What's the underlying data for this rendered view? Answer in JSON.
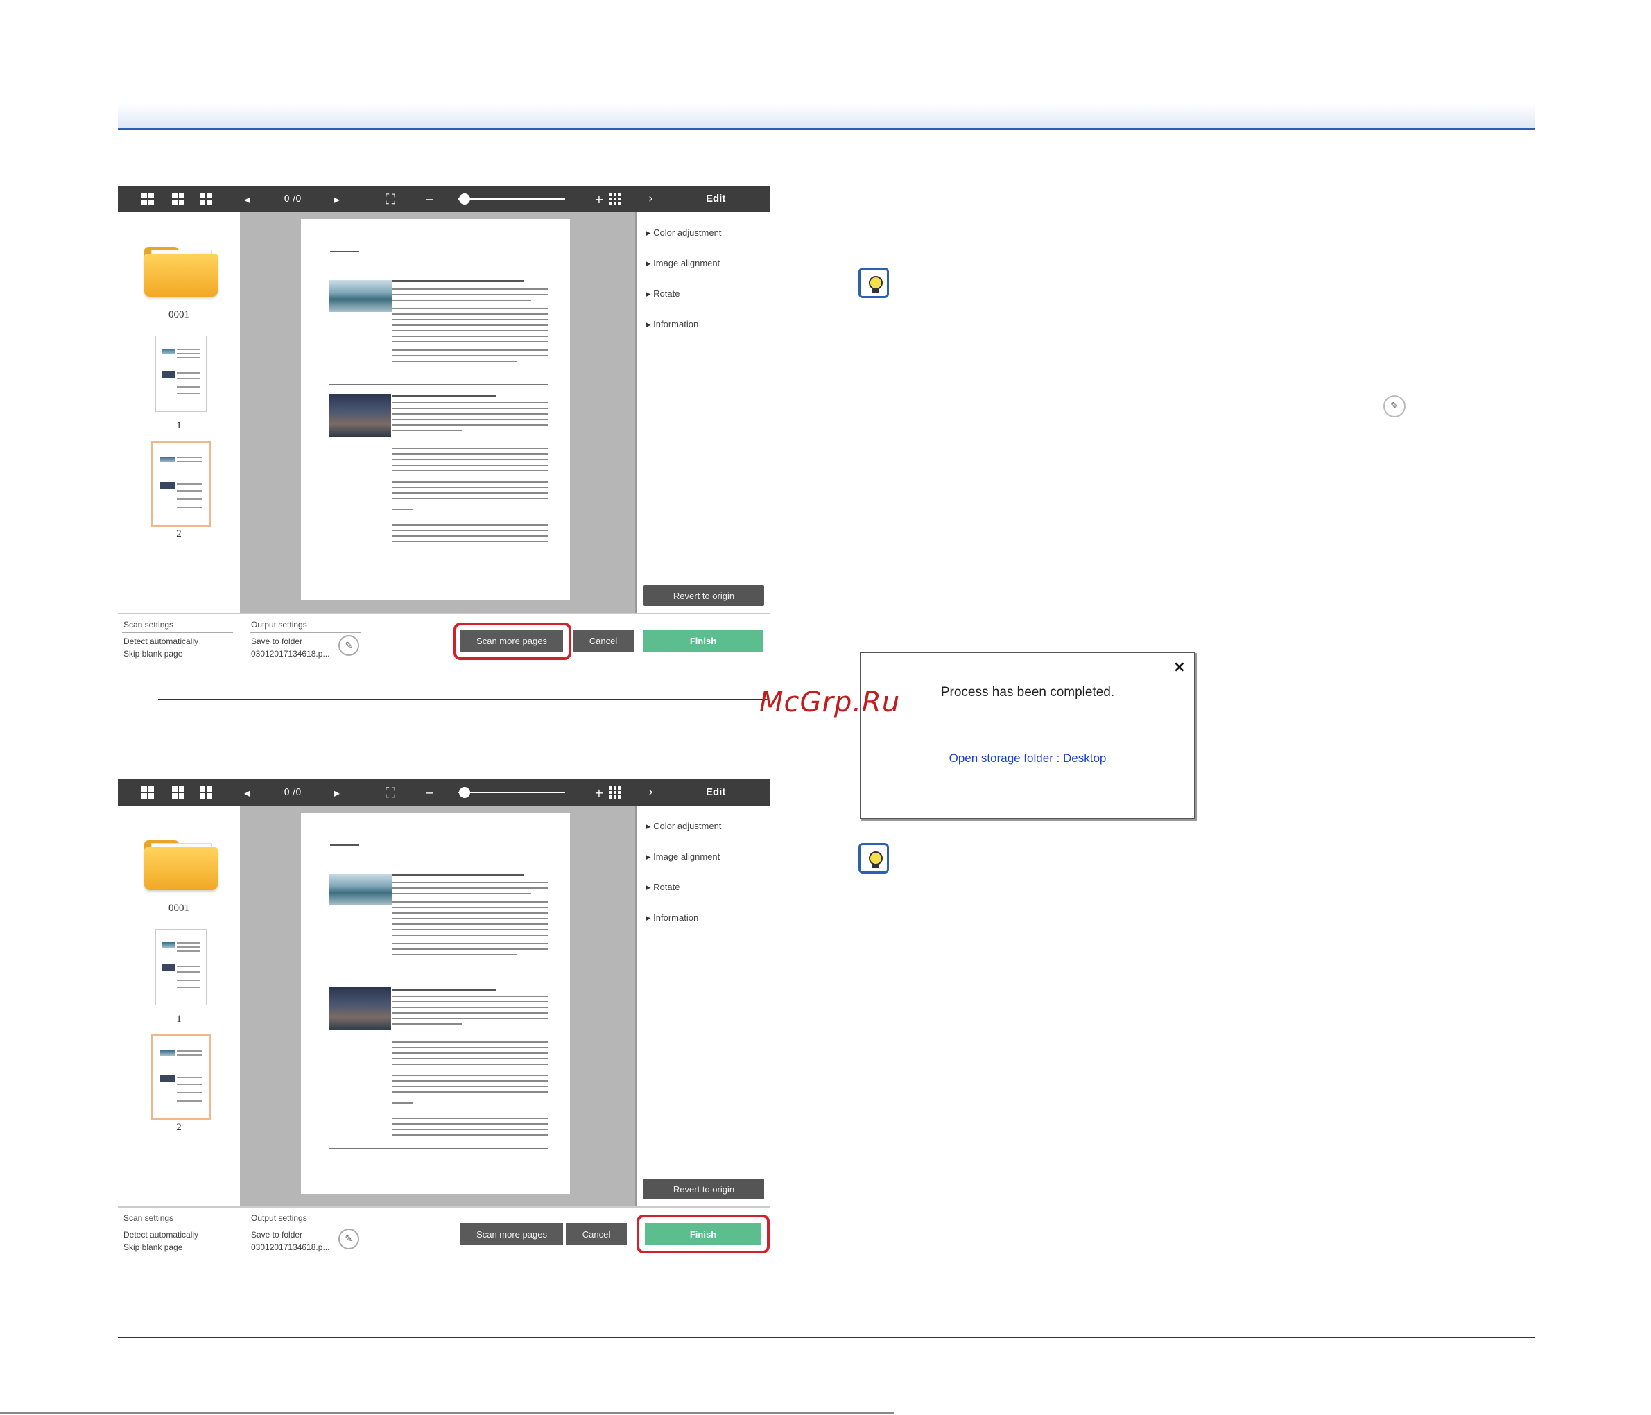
{
  "scan_windows": [
    {
      "toolbar": {
        "page_counter": "0 /0",
        "zoom_out": "−",
        "zoom_in": "+",
        "edit_title": "Edit"
      },
      "thumbnails": {
        "folder_label": "0001",
        "page1_label": "1",
        "page2_label": "2"
      },
      "edit_panel": {
        "items": [
          "Color adjustment",
          "Image alignment",
          "Rotate",
          "Information"
        ],
        "revert": "Revert to origin"
      },
      "bottom": {
        "scan_settings_title": "Scan settings",
        "scan_settings_1": "Detect automatically",
        "scan_settings_2": "Skip blank page",
        "output_settings_title": "Output settings",
        "output_settings_1": "Save to folder",
        "output_settings_2": "03012017134618.p...",
        "scan_more": "Scan more pages",
        "cancel": "Cancel",
        "finish": "Finish"
      },
      "highlighted_button": "scan-more-pages"
    },
    {
      "toolbar": {
        "page_counter": "0 /0",
        "zoom_out": "−",
        "zoom_in": "+",
        "edit_title": "Edit"
      },
      "thumbnails": {
        "folder_label": "0001",
        "page1_label": "1",
        "page2_label": "2"
      },
      "edit_panel": {
        "items": [
          "Color adjustment",
          "Image alignment",
          "Rotate",
          "Information"
        ],
        "revert": "Revert to origin"
      },
      "bottom": {
        "scan_settings_title": "Scan settings",
        "scan_settings_1": "Detect automatically",
        "scan_settings_2": "Skip blank page",
        "output_settings_title": "Output settings",
        "output_settings_1": "Save to folder",
        "output_settings_2": "03012017134618.p...",
        "scan_more": "Scan more pages",
        "cancel": "Cancel",
        "finish": "Finish"
      },
      "highlighted_button": "finish"
    }
  ],
  "dialog": {
    "message": "Process has been completed.",
    "link": "Open storage folder : Desktop",
    "close": "×"
  },
  "watermark": "McGrp.Ru",
  "colors": {
    "accent_blue": "#2b61b5",
    "finish_green": "#5cbd8e",
    "highlight_red": "#d4202a",
    "toolbar": "#3d3d3d"
  },
  "icons": [
    "grid-large-icon",
    "grid-medium-icon",
    "grid-small-icon",
    "prev-arrow-icon",
    "next-arrow-icon",
    "fit-page-icon",
    "thumbnail-grid-icon",
    "collapse-arrow-icon",
    "folder-icon",
    "pencil-icon",
    "lightbulb-tip-icon",
    "close-icon"
  ]
}
